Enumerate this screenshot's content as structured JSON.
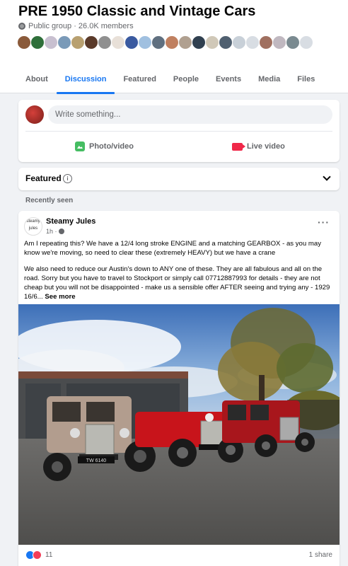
{
  "group": {
    "title": "PRE 1950 Classic and Vintage Cars",
    "meta": "Public group · 26.0K members"
  },
  "member_avatar_colors": [
    "#8a5a3a",
    "#2f6f3a",
    "#c8c0d0",
    "#7a9ab8",
    "#b8a070",
    "#5a3a2a",
    "#909090",
    "#e8e0d8",
    "#3a5aa0",
    "#a0c0e0",
    "#607080",
    "#c08060",
    "#b0a090",
    "#304050",
    "#d0c8b8",
    "#506070",
    "#c8d0d8",
    "#d8dde3",
    "#a07060",
    "#c0b8c0",
    "#7a8a90",
    "#d8dde3"
  ],
  "tabs": [
    {
      "label": "About"
    },
    {
      "label": "Discussion"
    },
    {
      "label": "Featured"
    },
    {
      "label": "People"
    },
    {
      "label": "Events"
    },
    {
      "label": "Media"
    },
    {
      "label": "Files"
    }
  ],
  "active_tab": "Discussion",
  "composer": {
    "placeholder": "Write something...",
    "photo_label": "Photo/video",
    "live_label": "Live video"
  },
  "featured": {
    "title": "Featured",
    "info": "i"
  },
  "recent_label": "Recently seen",
  "post": {
    "author": "Steamy Jules",
    "avatar_text": "steamy jules",
    "time": "1h ·",
    "text1": "Am I repeating this?  We have a 12/4 long stroke ENGINE and a matching GEARBOX - as you may know we're moving, so need to clear these (extremely HEAVY) but we have a crane",
    "text2": "We also need to reduce our Austin's down to ANY one of these. They are all fabulous and all on the road.  Sorry but you have to travel to Stockport or simply call 07712887993 for details - they are not cheap but you will not be disappointed - make us a sensible offer AFTER seeing and trying any - 1929 16/6...",
    "see_more": "See more",
    "more_icon": "···",
    "reactions_count": "11",
    "shares": "1 share",
    "plate_text": "TW 6140"
  },
  "colors": {
    "accent": "#1877f2",
    "background": "#f0f2f5",
    "photo_green": "#45bd62",
    "live_red": "#f02849"
  }
}
